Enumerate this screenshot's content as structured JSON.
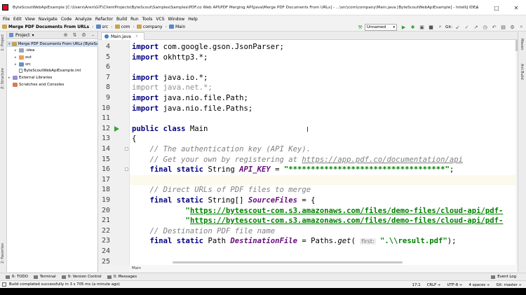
{
  "window": {
    "title": "ByteScoutWebApiExample [C:\\Users\\Aren\\GIT\\ClientProjects\\ByteScout\\Samples\\Samples\\PDF.co Web API\\PDF Merging API\\Java\\Merge PDF Documents From URLs] - ...\\src\\com\\company\\Main.java [ByteScoutWebApiExample] - IntelliJ IDEA",
    "minimize": "–",
    "maximize": "□",
    "close": "✕"
  },
  "menu": [
    "File",
    "Edit",
    "View",
    "Navigate",
    "Code",
    "Analyze",
    "Refactor",
    "Build",
    "Run",
    "Tools",
    "VCS",
    "Window",
    "Help"
  ],
  "breadcrumb": {
    "project": "Merge PDF Documents From URLs",
    "items": [
      "src",
      "com",
      "company",
      "Main"
    ]
  },
  "toolbar": {
    "run_config": "Unnamed",
    "git_label": "Git:"
  },
  "left_tabs": {
    "project": "1: Project",
    "structure": "Z: Structure",
    "favorites": "2: Favorites"
  },
  "right_tabs": {
    "maven": "Maven",
    "ant": "Ant Build"
  },
  "project_panel": {
    "header": "Project",
    "header_dropdown": "▾",
    "tree": [
      {
        "label": "Merge PDF Documents From URLs [ByteSc",
        "indent": 0,
        "arrow": "▾",
        "icon": "folder",
        "selected": true
      },
      {
        "label": ".idea",
        "indent": 1,
        "arrow": "▸",
        "icon": "folder-gray",
        "selected": false
      },
      {
        "label": "out",
        "indent": 1,
        "arrow": "▸",
        "icon": "folder-orange",
        "selected": false
      },
      {
        "label": "src",
        "indent": 1,
        "arrow": "▸",
        "icon": "folder-blue",
        "selected": false
      },
      {
        "label": "ByteScoutWebApiExample.iml",
        "indent": 1,
        "arrow": "",
        "icon": "file",
        "selected": false
      },
      {
        "label": "External Libraries",
        "indent": 0,
        "arrow": "▸",
        "icon": "library",
        "selected": false
      },
      {
        "label": "Scratches and Consoles",
        "indent": 0,
        "arrow": "",
        "icon": "scratch",
        "selected": false
      }
    ]
  },
  "editor": {
    "tab_label": "Main.java",
    "tab_close": "×",
    "bottom_crumb": "Main",
    "lines": [
      {
        "n": "4",
        "tokens": [
          [
            "kw",
            "import"
          ],
          [
            "",
            " com.google.gson.JsonParser;"
          ]
        ]
      },
      {
        "n": "5",
        "tokens": [
          [
            "kw",
            "import"
          ],
          [
            "",
            " okhttp3.*;"
          ]
        ]
      },
      {
        "n": "6",
        "tokens": []
      },
      {
        "n": "7",
        "tokens": [
          [
            "kw",
            "import"
          ],
          [
            "",
            " java.io.*;"
          ]
        ]
      },
      {
        "n": "8",
        "tokens": [
          [
            "unused",
            "import java.net.*;"
          ]
        ]
      },
      {
        "n": "9",
        "tokens": [
          [
            "kw",
            "import"
          ],
          [
            "",
            " java.nio.file.Path;"
          ]
        ]
      },
      {
        "n": "10",
        "tokens": [
          [
            "kw",
            "import"
          ],
          [
            "",
            " java.nio.file.Paths;"
          ]
        ]
      },
      {
        "n": "11",
        "tokens": []
      },
      {
        "n": "12",
        "tokens": [
          [
            "kw",
            "public class"
          ],
          [
            "",
            " Main"
          ]
        ]
      },
      {
        "n": "13",
        "tokens": [
          [
            "",
            "{"
          ]
        ]
      },
      {
        "n": "14",
        "tokens": [
          [
            "",
            "    "
          ],
          [
            "cm",
            "// The authentication key (API Key)."
          ]
        ]
      },
      {
        "n": "15",
        "tokens": [
          [
            "",
            "    "
          ],
          [
            "cm",
            "// Get your own by registering at "
          ],
          [
            "lk",
            "https://app.pdf.co/documentation/api"
          ]
        ]
      },
      {
        "n": "16",
        "tokens": [
          [
            "",
            "    "
          ],
          [
            "kw",
            "final static"
          ],
          [
            "",
            " String "
          ],
          [
            "cn",
            "API_KEY"
          ],
          [
            "",
            " = "
          ],
          [
            "st",
            "\"***********************************\""
          ],
          [
            "",
            ";"
          ]
        ]
      },
      {
        "n": "17",
        "tokens": []
      },
      {
        "n": "18",
        "tokens": [
          [
            "",
            "    "
          ],
          [
            "cm",
            "// Direct URLs of PDF files to merge"
          ]
        ]
      },
      {
        "n": "19",
        "tokens": [
          [
            "",
            "    "
          ],
          [
            "kw",
            "final static"
          ],
          [
            "",
            " String[] "
          ],
          [
            "cn",
            "SourceFiles"
          ],
          [
            "",
            " = {"
          ]
        ]
      },
      {
        "n": "20",
        "tokens": [
          [
            "",
            "            "
          ],
          [
            "st",
            "\""
          ],
          [
            "stl",
            "https://bytescout-com.s3.amazonaws.com/files/demo-files/cloud-api/pdf-"
          ]
        ]
      },
      {
        "n": "21",
        "tokens": [
          [
            "",
            "            "
          ],
          [
            "st",
            "\""
          ],
          [
            "stl",
            "https://bytescout-com.s3.amazonaws.com/files/demo-files/cloud-api/pdf-"
          ]
        ]
      },
      {
        "n": "22",
        "tokens": [
          [
            "",
            "    "
          ],
          [
            "cm",
            "// Destination PDF file name"
          ]
        ]
      },
      {
        "n": "23",
        "tokens": [
          [
            "",
            "    "
          ],
          [
            "kw",
            "final static"
          ],
          [
            "",
            " Path "
          ],
          [
            "cn",
            "DestinationFile"
          ],
          [
            "",
            " = Paths."
          ],
          [
            "mt",
            "get"
          ],
          [
            "",
            "( "
          ],
          [
            "hint",
            "first:"
          ],
          [
            "",
            " "
          ],
          [
            "st",
            "\".\\\\result.pdf\""
          ],
          [
            "",
            ");"
          ]
        ]
      },
      {
        "n": "24",
        "tokens": []
      },
      {
        "n": "25",
        "tokens": []
      }
    ]
  },
  "tool_windows": [
    "6: TODO",
    "Terminal",
    "9: Version Control",
    "0: Messages"
  ],
  "event_log": "Event Log",
  "status": {
    "message": "Build completed successfully in 3 s 705 ms (a minute ago)",
    "position": "17:1",
    "line_sep": "CRLF ÷",
    "encoding": "UTF-8 ÷",
    "indent": "4 spaces ÷",
    "git": "Git: master ÷"
  },
  "colors": {
    "keyword": "#000080",
    "comment": "#808080",
    "string": "#008000",
    "constant": "#660e7a",
    "run_marker": "#3aa03a"
  }
}
